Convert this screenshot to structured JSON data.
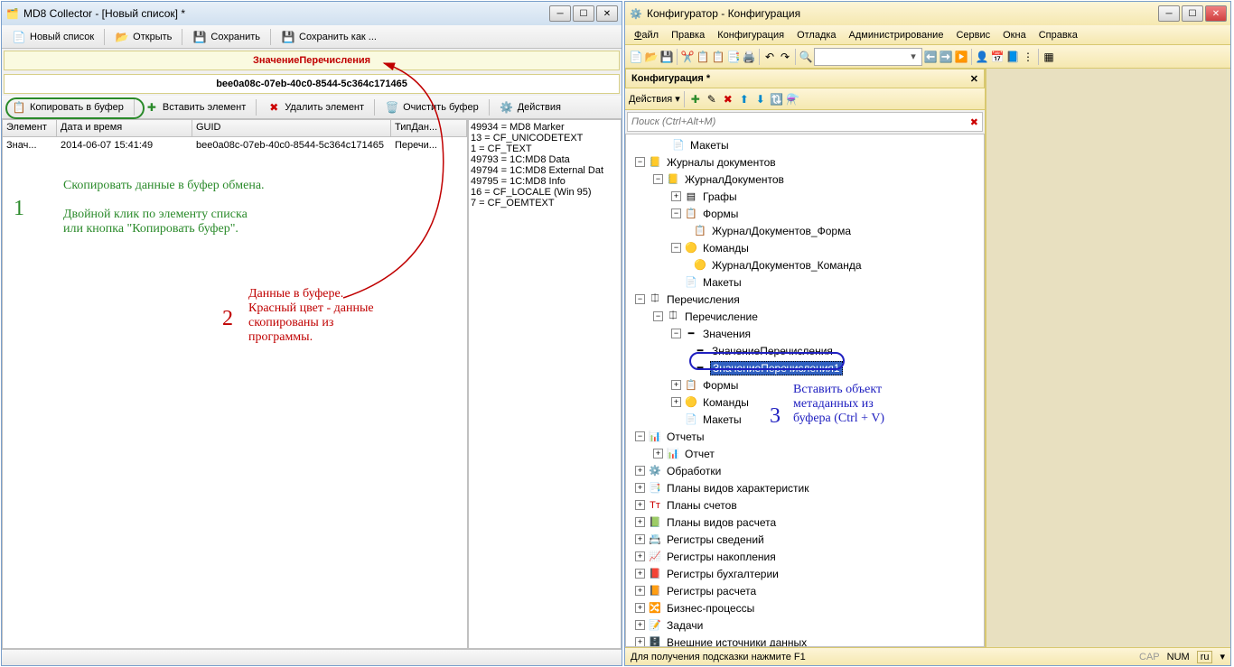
{
  "left_window": {
    "title": "MD8 Collector - [Новый список] *",
    "toolbar": {
      "new_list": "Новый список",
      "open": "Открыть",
      "save": "Сохранить",
      "save_as": "Сохранить как ..."
    },
    "info_red": "ЗначениеПеречисления",
    "info_guid": "bee0a08c-07eb-40c0-8544-5c364c171465",
    "toolbar2": {
      "copy_buf": "Копировать в буфер",
      "insert_elem": "Вставить элемент",
      "delete_elem": "Удалить элемент",
      "clear_buf": "Очистить буфер",
      "actions": "Действия"
    },
    "list_cols": {
      "element": "Элемент",
      "datetime": "Дата и время",
      "guid": "GUID",
      "type": "ТипДан..."
    },
    "list_row": {
      "element": "Знач...",
      "datetime": "2014-06-07 15:41:49",
      "guid": "bee0a08c-07eb-40c0-8544-5c364c171465",
      "type": "Перечи..."
    },
    "side_panel": [
      "49934 = MD8 Marker",
      "13 = CF_UNICODETEXT",
      "1 = CF_TEXT",
      "49793 = 1C:MD8 Data",
      "49794 = 1C:MD8 External Dat",
      "49795 = 1C:MD8 Info",
      "16 = CF_LOCALE (Win 95)",
      "7 = CF_OEMTEXT"
    ]
  },
  "annotations": {
    "n1": "1",
    "n2": "2",
    "n3": "3",
    "green_text": "Скопировать данные в буфер обмена.\n\nДвойной клик по элементу списка\nили кнопка \"Копировать буфер\".",
    "red_text": "Данные в буфере.\nКрасный цвет - данные\nскопированы из\nпрограммы.",
    "blue_text": "Вставить объект\nметаданных из\nбуфера (Ctrl + V)"
  },
  "right_window": {
    "title": "Конфигуратор - Конфигурация",
    "menu": {
      "file": "Файл",
      "edit": "Правка",
      "config": "Конфигурация",
      "debug": "Отладка",
      "admin": "Администрирование",
      "service": "Сервис",
      "windows": "Окна",
      "help": "Справка"
    },
    "panel_title": "Конфигурация *",
    "actions_label": "Действия",
    "search_placeholder": "Поиск (Ctrl+Alt+M)",
    "tree": {
      "makety": "Макеты",
      "journals": "Журналы документов",
      "journal_doc": "ЖурналДокументов",
      "grafy": "Графы",
      "formy": "Формы",
      "journal_form": "ЖурналДокументов_Форма",
      "komandy": "Команды",
      "journal_cmd": "ЖурналДокументов_Команда",
      "enums": "Перечисления",
      "enum": "Перечисление",
      "values": "Значения",
      "enum_val": "ЗначениеПеречисления",
      "enum_val1": "ЗначениеПеречисления1",
      "reports": "Отчеты",
      "report": "Отчет",
      "processing": "Обработки",
      "char_plans": "Планы видов характеристик",
      "acc_plans": "Планы счетов",
      "calc_plans": "Планы видов расчета",
      "info_reg": "Регистры сведений",
      "accum_reg": "Регистры накопления",
      "buh_reg": "Регистры бухгалтерии",
      "calc_reg": "Регистры расчета",
      "bp": "Бизнес-процессы",
      "tasks": "Задачи",
      "ext_data": "Внешние источники данных"
    },
    "statusbar": {
      "hint": "Для получения подсказки нажмите F1",
      "cap": "CAP",
      "num": "NUM",
      "lang": "ru"
    }
  }
}
